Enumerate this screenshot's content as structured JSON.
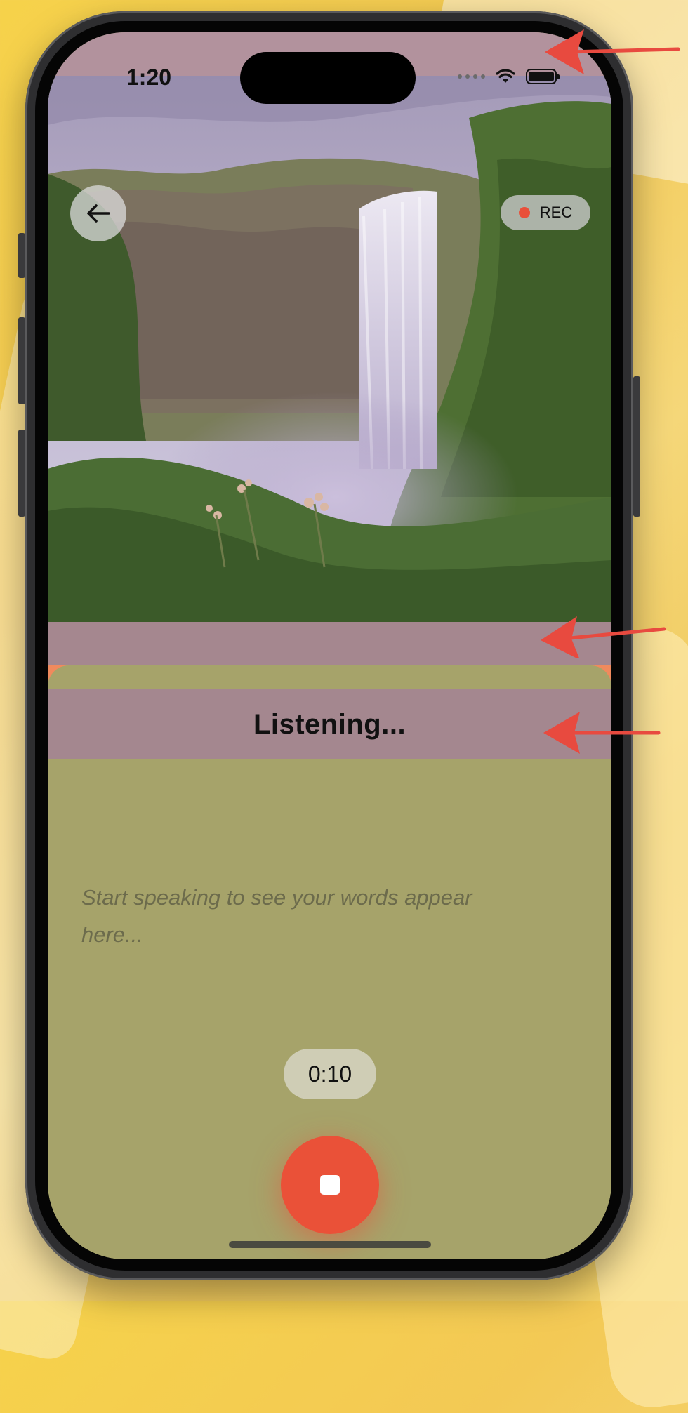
{
  "status_bar": {
    "time": "1:20",
    "icons": [
      "cellular-dots-icon",
      "wifi-icon",
      "battery-icon"
    ]
  },
  "hero": {
    "image": "waterfall-landscape",
    "back_icon": "arrow-left-icon",
    "rec_label": "REC"
  },
  "sheet": {
    "status_text": "Listening...",
    "placeholder": "Start speaking to see your words appear here...",
    "timer": "0:10",
    "stop_icon": "stop-icon"
  },
  "annotations": {
    "arrow_color": "#e84a3f",
    "count": 3
  },
  "colors": {
    "overlay_pink": "#b2929d",
    "sheet_olive": "#a6a36a",
    "stop_red": "#ea5138",
    "rec_dot": "#e9503a"
  }
}
